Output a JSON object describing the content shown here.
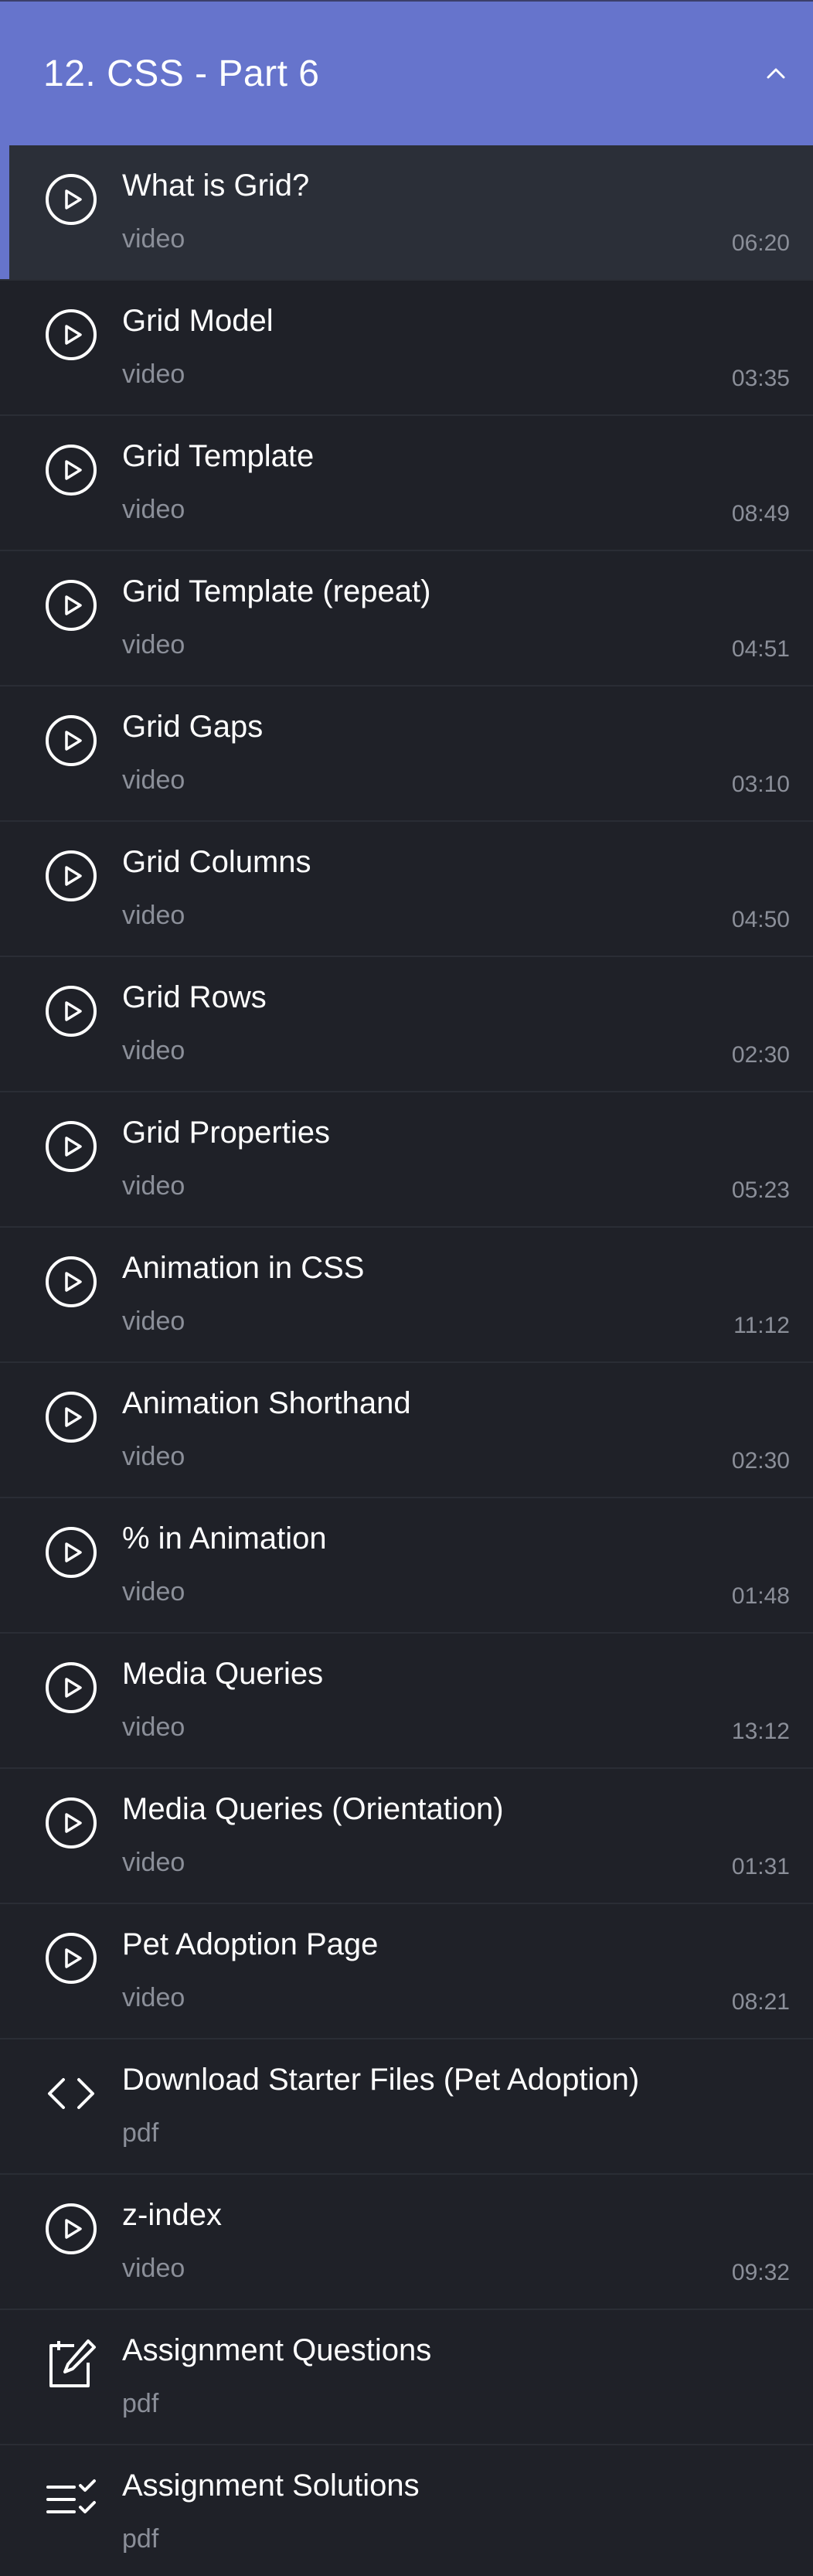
{
  "section": {
    "title": "12. CSS - Part 6",
    "collapse_icon": "chevron-up-icon",
    "accent_color": "#6674cc"
  },
  "items": [
    {
      "title": "What is Grid?",
      "type": "video",
      "duration": "06:20",
      "icon": "play-circle-icon",
      "active": true
    },
    {
      "title": "Grid Model",
      "type": "video",
      "duration": "03:35",
      "icon": "play-circle-icon"
    },
    {
      "title": "Grid Template",
      "type": "video",
      "duration": "08:49",
      "icon": "play-circle-icon"
    },
    {
      "title": "Grid Template (repeat)",
      "type": "video",
      "duration": "04:51",
      "icon": "play-circle-icon"
    },
    {
      "title": "Grid Gaps",
      "type": "video",
      "duration": "03:10",
      "icon": "play-circle-icon"
    },
    {
      "title": "Grid Columns",
      "type": "video",
      "duration": "04:50",
      "icon": "play-circle-icon"
    },
    {
      "title": "Grid Rows",
      "type": "video",
      "duration": "02:30",
      "icon": "play-circle-icon"
    },
    {
      "title": "Grid Properties",
      "type": "video",
      "duration": "05:23",
      "icon": "play-circle-icon"
    },
    {
      "title": "Animation in CSS",
      "type": "video",
      "duration": "11:12",
      "icon": "play-circle-icon"
    },
    {
      "title": "Animation Shorthand",
      "type": "video",
      "duration": "02:30",
      "icon": "play-circle-icon"
    },
    {
      "title": "% in Animation",
      "type": "video",
      "duration": "01:48",
      "icon": "play-circle-icon"
    },
    {
      "title": "Media Queries",
      "type": "video",
      "duration": "13:12",
      "icon": "play-circle-icon"
    },
    {
      "title": "Media Queries (Orientation)",
      "type": "video",
      "duration": "01:31",
      "icon": "play-circle-icon"
    },
    {
      "title": "Pet Adoption Page",
      "type": "video",
      "duration": "08:21",
      "icon": "play-circle-icon"
    },
    {
      "title": "Download Starter Files (Pet Adoption)",
      "type": "pdf",
      "duration": "",
      "icon": "code-icon"
    },
    {
      "title": "z-index",
      "type": "video",
      "duration": "09:32",
      "icon": "play-circle-icon"
    },
    {
      "title": "Assignment Questions",
      "type": "pdf",
      "duration": "",
      "icon": "edit-icon"
    },
    {
      "title": "Assignment Solutions",
      "type": "pdf",
      "duration": "",
      "icon": "checklist-icon"
    }
  ]
}
